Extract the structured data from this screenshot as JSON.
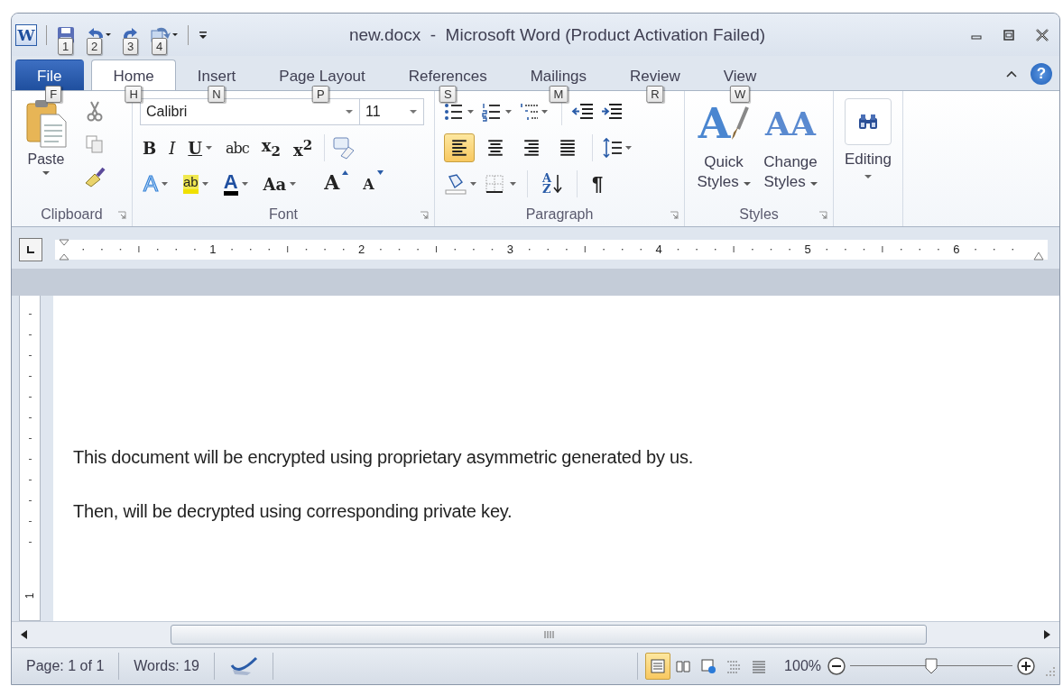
{
  "window": {
    "title": "new.docx  -  Microsoft Word (Product Activation Failed)",
    "app_glyph": "W"
  },
  "quick_access": [
    {
      "kind": "save",
      "keytip": "1"
    },
    {
      "kind": "undo",
      "keytip": "2"
    },
    {
      "kind": "redo",
      "keytip": "3"
    },
    {
      "kind": "repeat",
      "keytip": "4"
    }
  ],
  "tabs": [
    {
      "label": "File",
      "keytip": "F",
      "selected": false,
      "kind": "file"
    },
    {
      "label": "Home",
      "keytip": "H",
      "selected": true,
      "kind": "tab"
    },
    {
      "label": "Insert",
      "keytip": "N",
      "selected": false,
      "kind": "tab"
    },
    {
      "label": "Page Layout",
      "keytip": "P",
      "selected": false,
      "kind": "tab"
    },
    {
      "label": "References",
      "keytip": "S",
      "selected": false,
      "kind": "tab"
    },
    {
      "label": "Mailings",
      "keytip": "M",
      "selected": false,
      "kind": "tab"
    },
    {
      "label": "Review",
      "keytip": "R",
      "selected": false,
      "kind": "tab"
    },
    {
      "label": "View",
      "keytip": "W",
      "selected": false,
      "kind": "tab"
    }
  ],
  "help_glyph": "?",
  "clipboard": {
    "paste": "Paste",
    "label": "Clipboard"
  },
  "font": {
    "name": "Calibri",
    "size": "11",
    "label": "Font",
    "format_buttons": [
      {
        "glyph": "B",
        "kind": "bold"
      },
      {
        "glyph": "I",
        "kind": "italic"
      },
      {
        "glyph": "U",
        "kind": "underline"
      },
      {
        "glyph": "abc",
        "kind": "strike"
      },
      {
        "glyph": "x$_{2}$",
        "kind": "sub"
      },
      {
        "glyph": "x$^{2}$",
        "kind": "sup"
      }
    ],
    "style_buttons": [
      {
        "glyph": "A",
        "kind": "effects"
      },
      {
        "glyph": "ab",
        "kind": "highlight"
      },
      {
        "glyph": "A",
        "kind": "color"
      },
      {
        "glyph": "Aa",
        "kind": "case"
      },
      {
        "glyph": "A",
        "kind": "grow"
      },
      {
        "glyph": "A",
        "kind": "shrink"
      }
    ]
  },
  "paragraph": {
    "label": "Paragraph",
    "alignment": [
      {
        "kind": "left",
        "selected": true
      },
      {
        "kind": "center",
        "selected": false
      },
      {
        "kind": "right",
        "selected": false
      },
      {
        "kind": "justify",
        "selected": false
      }
    ],
    "sort_glyph": "AZ",
    "marks_glyph": "¶"
  },
  "styles": {
    "label": "Styles",
    "quick": {
      "glyph": "A",
      "line1": "Quick",
      "line2": "Styles"
    },
    "change": {
      "glyph": "AA",
      "line1": "Change",
      "line2": "Styles"
    }
  },
  "editing": {
    "label": "Editing"
  },
  "ruler": {
    "marks": [
      "1",
      "2",
      "3",
      "4",
      "5",
      "6"
    ],
    "vertical_marks": [
      "1"
    ]
  },
  "document": {
    "paragraphs": [
      "This document will be encrypted using proprietary asymmetric generated by us.",
      "Then, will be decrypted using corresponding private key."
    ]
  },
  "status_bar": {
    "page": "Page: 1 of 1",
    "words": "Words: 19",
    "views": [
      {
        "kind": "print",
        "selected": true
      },
      {
        "kind": "reading",
        "selected": false
      },
      {
        "kind": "web",
        "selected": false
      },
      {
        "kind": "outline",
        "selected": false
      },
      {
        "kind": "draft",
        "selected": false
      }
    ],
    "zoom": "100%",
    "zoom_slider": {
      "level": 0.5
    }
  }
}
